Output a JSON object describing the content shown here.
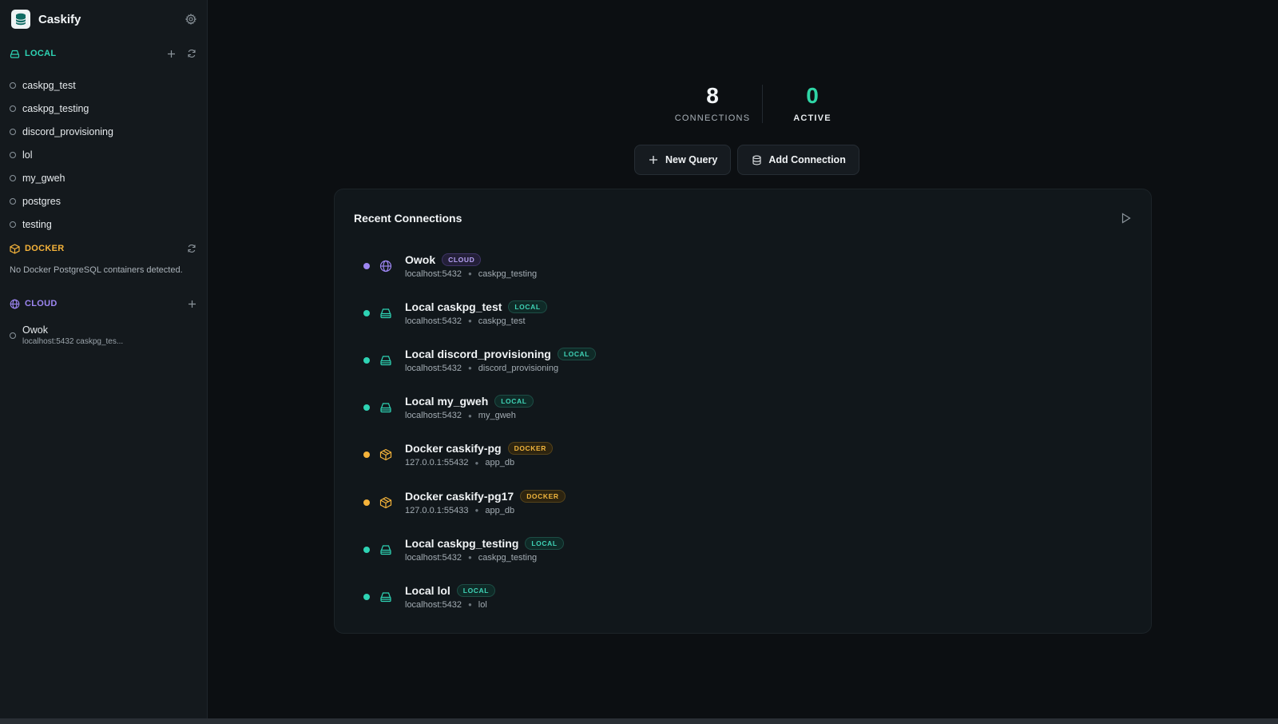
{
  "app": {
    "title": "Caskify"
  },
  "sidebar": {
    "local": {
      "label": "LOCAL",
      "items": [
        {
          "label": "caskpg_test"
        },
        {
          "label": "caskpg_testing"
        },
        {
          "label": "discord_provisioning"
        },
        {
          "label": "lol"
        },
        {
          "label": "my_gweh"
        },
        {
          "label": "postgres"
        },
        {
          "label": "testing"
        }
      ]
    },
    "docker": {
      "label": "DOCKER",
      "empty_text": "No Docker PostgreSQL containers detected."
    },
    "cloud": {
      "label": "CLOUD",
      "items": [
        {
          "label": "Owok",
          "sub": "localhost:5432 caskpg_tes..."
        }
      ]
    }
  },
  "stats": {
    "connections": {
      "value": "8",
      "label": "CONNECTIONS"
    },
    "active": {
      "value": "0",
      "label": "ACTIVE"
    }
  },
  "buttons": {
    "new_query": "New Query",
    "add_connection": "Add Connection"
  },
  "recent": {
    "title": "Recent Connections",
    "items": [
      {
        "name": "Owok",
        "badge": "CLOUD",
        "host": "localhost:5432",
        "db": "caskpg_testing",
        "type": "cloud"
      },
      {
        "name": "Local caskpg_test",
        "badge": "LOCAL",
        "host": "localhost:5432",
        "db": "caskpg_test",
        "type": "local"
      },
      {
        "name": "Local discord_provisioning",
        "badge": "LOCAL",
        "host": "localhost:5432",
        "db": "discord_provisioning",
        "type": "local"
      },
      {
        "name": "Local my_gweh",
        "badge": "LOCAL",
        "host": "localhost:5432",
        "db": "my_gweh",
        "type": "local"
      },
      {
        "name": "Docker caskify-pg",
        "badge": "DOCKER",
        "host": "127.0.0.1:55432",
        "db": "app_db",
        "type": "docker"
      },
      {
        "name": "Docker caskify-pg17",
        "badge": "DOCKER",
        "host": "127.0.0.1:55433",
        "db": "app_db",
        "type": "docker"
      },
      {
        "name": "Local caskpg_testing",
        "badge": "LOCAL",
        "host": "localhost:5432",
        "db": "caskpg_testing",
        "type": "local"
      },
      {
        "name": "Local lol",
        "badge": "LOCAL",
        "host": "localhost:5432",
        "db": "lol",
        "type": "local"
      }
    ]
  },
  "colors": {
    "local": "#2ed3b4",
    "docker": "#f5b33a",
    "cloud": "#9d86f2",
    "active_green": "#2fd6a6"
  }
}
